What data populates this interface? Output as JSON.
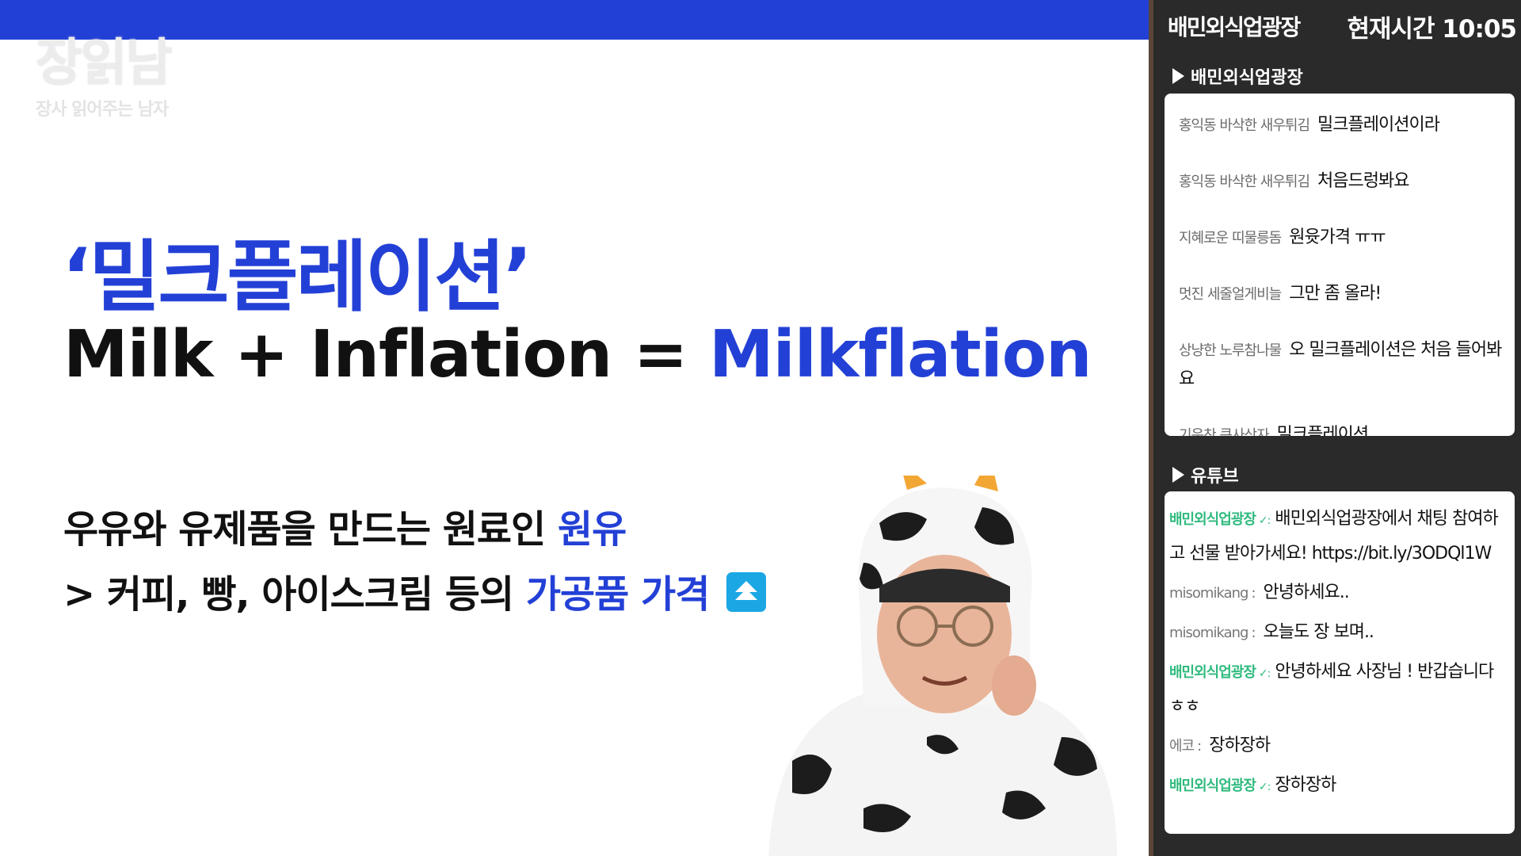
{
  "slide": {
    "logo": {
      "main": "장읽남",
      "sub": "장사 읽어주는 남자"
    },
    "title": "‘밀크플레이션’",
    "equation": {
      "left": "Milk + Inflation = ",
      "result": "Milkflation"
    },
    "desc1": {
      "text": "우유와 유제품을 만드는 원료인 ",
      "highlight": "원유"
    },
    "desc2": {
      "text": "> 커피, 빵, 아이스크림 등의 ",
      "highlight": "가공품 가격"
    },
    "icon": "up-arrow-icon",
    "colors": {
      "accent": "#2340d6",
      "topbar": "#2340d6",
      "icon_bg": "#1ba7e3"
    }
  },
  "panel": {
    "brand": "배민외식업광장",
    "clock": "현재시간 10:05",
    "section1_title": "배민외식업광장",
    "section2_title": "유튜브",
    "chat1": [
      {
        "nick": "홍익동 바삭한 새우튀김",
        "text": "밀크플레이션이라"
      },
      {
        "nick": "홍익동 바삭한 새우튀김",
        "text": "처음드렁봐요"
      },
      {
        "nick": "지혜로운 띠물릉돔",
        "text": "원윳가격 ㅠㅠ"
      },
      {
        "nick": "멋진 세줄얼게비늘",
        "text": "그만 좀 올라!"
      },
      {
        "nick": "상냥한 노루참나물",
        "text": "오 밀크플레이션은 처음 들어봐요"
      },
      {
        "nick": "기운찬 큰사상자",
        "text": "밀크플레이션"
      }
    ],
    "chat2": [
      {
        "nick": "배민외식업광장",
        "verified": true,
        "text": "배민외식업광장에서 채팅 참여하고 선물 받아가세요! https://bit.ly/3ODQl1W"
      },
      {
        "nick": "misomikang",
        "verified": false,
        "text": "안녕하세요.."
      },
      {
        "nick": "misomikang",
        "verified": false,
        "text": "오늘도 장 보며.."
      },
      {
        "nick": "배민외식업광장",
        "verified": true,
        "text": "안녕하세요 사장님 ! 반갑습니다 ㅎㅎ"
      },
      {
        "nick": "에코",
        "verified": false,
        "text": "장하장하"
      },
      {
        "nick": "배민외식업광장",
        "verified": true,
        "text": "장하장하"
      }
    ],
    "colors": {
      "panel_bg": "#2a2a2a",
      "verified_nick": "#2fba7d"
    }
  }
}
